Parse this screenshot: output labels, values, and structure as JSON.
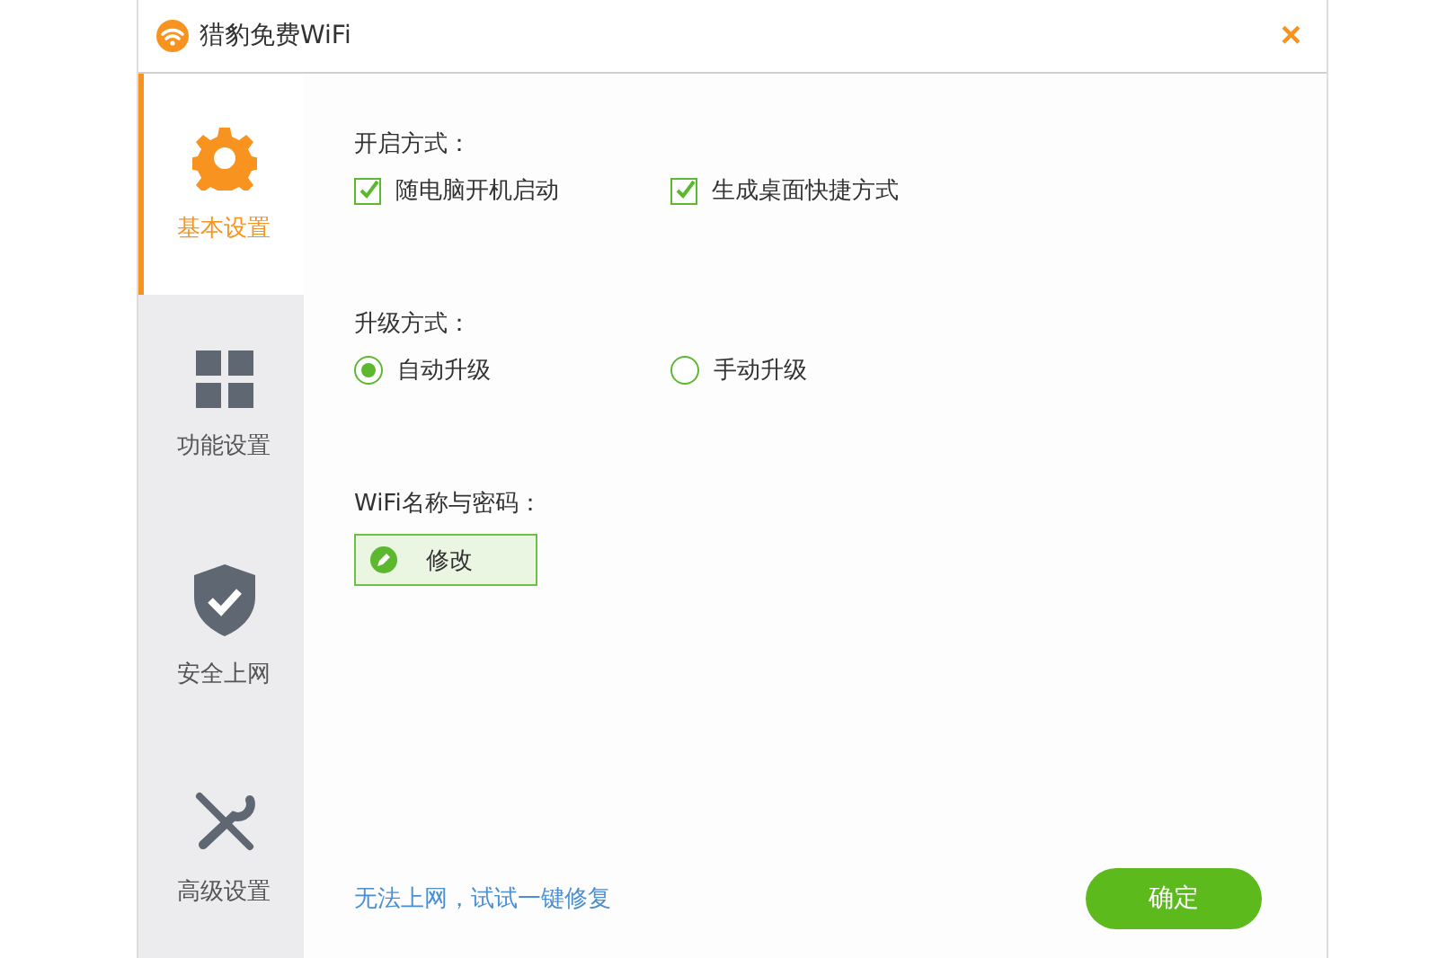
{
  "window": {
    "title": "猎豹免费WiFi",
    "close": "×"
  },
  "sidebar": {
    "items": [
      {
        "label": "基本设置",
        "selected": true
      },
      {
        "label": "功能设置",
        "selected": false
      },
      {
        "label": "安全上网",
        "selected": false
      },
      {
        "label": "高级设置",
        "selected": false
      }
    ]
  },
  "startup": {
    "label": "开启方式：",
    "options": [
      {
        "label": "随电脑开机启动",
        "checked": true
      },
      {
        "label": "生成桌面快捷方式",
        "checked": true
      }
    ]
  },
  "upgrade": {
    "label": "升级方式：",
    "options": [
      {
        "label": "自动升级",
        "selected": true
      },
      {
        "label": "手动升级",
        "selected": false
      }
    ]
  },
  "wifi": {
    "label": "WiFi名称与密码：",
    "button": "修改"
  },
  "footer": {
    "link": "无法上网，试试一键修复",
    "confirm": "确定"
  }
}
